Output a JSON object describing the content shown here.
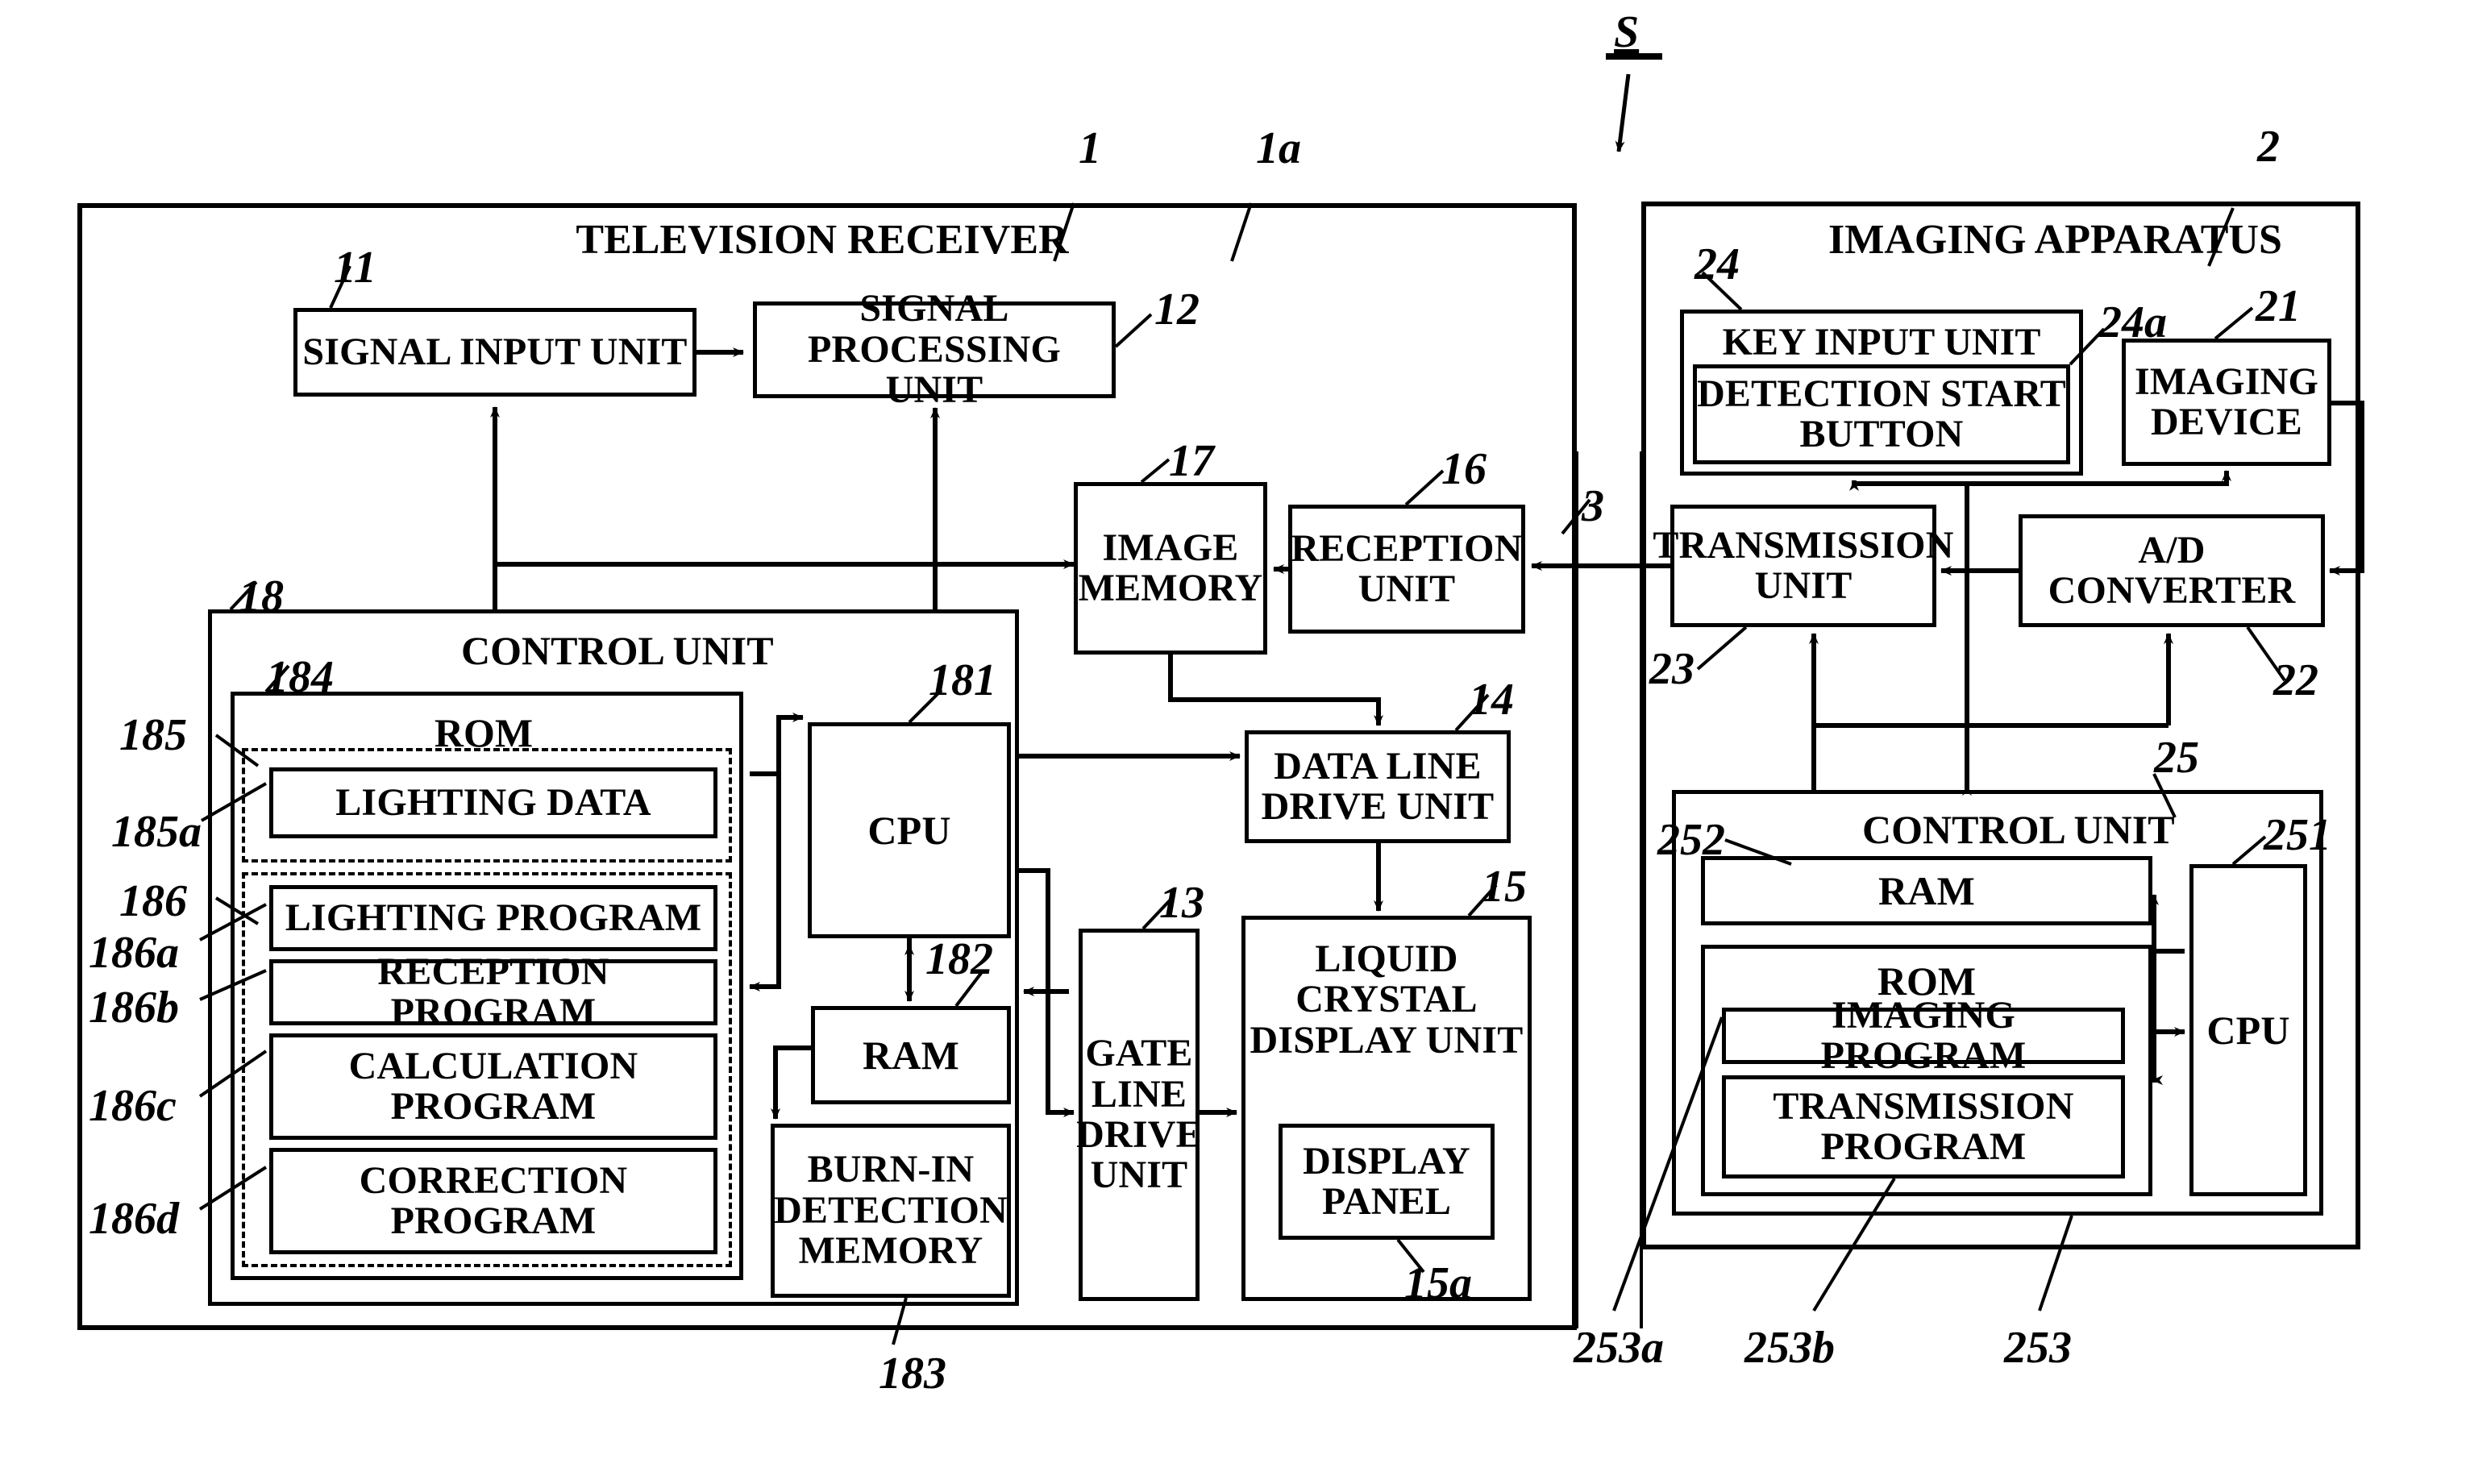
{
  "figure": {
    "system_label": "S",
    "television_receiver": {
      "title": "TELEVISION RECEIVER",
      "ref": "1",
      "ref_secondary": "1a",
      "blocks": {
        "signal_input_unit": {
          "label": "SIGNAL INPUT UNIT",
          "ref": "11"
        },
        "signal_processing_unit": {
          "label": "SIGNAL PROCESSING UNIT",
          "ref": "12"
        },
        "image_memory": {
          "label": "IMAGE MEMORY",
          "ref": "17"
        },
        "reception_unit": {
          "label": "RECEPTION UNIT",
          "ref": "16"
        },
        "data_line_drive_unit": {
          "label": "DATA LINE DRIVE UNIT",
          "ref": "14"
        },
        "gate_line_drive_unit": {
          "label": "GATE LINE DRIVE UNIT",
          "ref": "13"
        },
        "liquid_crystal_display_unit": {
          "label": "LIQUID CRYSTAL DISPLAY UNIT",
          "ref": "15"
        },
        "display_panel": {
          "label": "DISPLAY PANEL",
          "ref": "15a"
        },
        "control_unit": {
          "label": "CONTROL UNIT",
          "ref": "18"
        },
        "rom": {
          "label": "ROM",
          "ref": "184"
        },
        "lighting_data": {
          "label": "LIGHTING DATA",
          "ref": "185a",
          "group_ref": "185"
        },
        "lighting_program": {
          "label": "LIGHTING PROGRAM",
          "ref": "186a",
          "group_ref": "186"
        },
        "reception_program": {
          "label": "RECEPTION PROGRAM",
          "ref": "186b"
        },
        "calculation_program": {
          "label": "CALCULATION PROGRAM",
          "ref": "186c"
        },
        "correction_program": {
          "label": "CORRECTION PROGRAM",
          "ref": "186d"
        },
        "cpu": {
          "label": "CPU",
          "ref": "181"
        },
        "ram": {
          "label": "RAM",
          "ref": "182"
        },
        "burn_in_detection_memory": {
          "label": "BURN-IN DETECTION MEMORY",
          "ref": "183"
        }
      }
    },
    "imaging_apparatus": {
      "title": "IMAGING APPARATUS",
      "ref": "2",
      "blocks": {
        "key_input_unit": {
          "label": "KEY INPUT UNIT",
          "ref": "24"
        },
        "detection_start_button": {
          "label": "DETECTION START BUTTON",
          "ref": "24a"
        },
        "imaging_device": {
          "label": "IMAGING DEVICE",
          "ref": "21"
        },
        "transmission_unit": {
          "label": "TRANSMISSION UNIT",
          "ref": "23"
        },
        "ad_converter": {
          "label": "A/D CONVERTER",
          "ref": "22"
        },
        "control_unit": {
          "label": "CONTROL UNIT",
          "ref": "25"
        },
        "ram": {
          "label": "RAM",
          "ref": "252"
        },
        "rom": {
          "label": "ROM",
          "ref": "253"
        },
        "imaging_program": {
          "label": "IMAGING PROGRAM",
          "ref": "253a"
        },
        "transmission_program": {
          "label": "TRANSMISSION PROGRAM",
          "ref": "253b"
        },
        "cpu": {
          "label": "CPU",
          "ref": "251"
        }
      }
    },
    "link": {
      "ref": "3"
    }
  }
}
